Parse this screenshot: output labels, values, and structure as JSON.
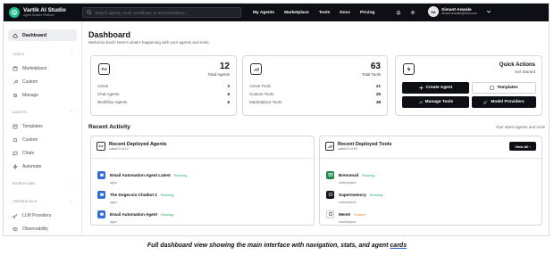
{
  "app": {
    "title": "Vartik AI Studio",
    "subtitle": "Agent Builder Platform"
  },
  "search": {
    "placeholder": "Search agents, tools, workflows, or documentation..."
  },
  "topnav": [
    "My Agents",
    "Marketplace",
    "Tools",
    "Docs",
    "Pricing"
  ],
  "user": {
    "initials": "SA",
    "name": "Simant Aswale",
    "email": "simant.aswale@emo.com"
  },
  "sidebar": {
    "dashboard": "Dashboard",
    "sections": [
      {
        "title": "TOOLS",
        "items": [
          "Marketplace",
          "Custom",
          "Manage"
        ]
      },
      {
        "title": "AGENTS",
        "items": [
          "Templates",
          "Custom",
          "Chats",
          "Automate"
        ]
      },
      {
        "title": "WORKFLOWS",
        "items": []
      },
      {
        "title": "CREDENTIALS",
        "items": [
          "LLM Providers",
          "Observability"
        ]
      }
    ]
  },
  "main": {
    "title": "Dashboard",
    "subtitle": "Welcome back! Here's what's happening with your agents and tools."
  },
  "agents_card": {
    "total": "12",
    "total_label": "Total Agents",
    "rows": [
      {
        "label": "Active",
        "value": "3"
      },
      {
        "label": "Chat Agents",
        "value": "6"
      },
      {
        "label": "Workflow Agents",
        "value": "6"
      }
    ]
  },
  "tools_card": {
    "total": "63",
    "total_label": "Total Tools",
    "rows": [
      {
        "label": "Active Tools",
        "value": "21"
      },
      {
        "label": "Custom Tools",
        "value": "25"
      },
      {
        "label": "Marketplace Tools",
        "value": "38"
      }
    ]
  },
  "quick_actions": {
    "title": "Quick Actions",
    "subtitle": "Get Started",
    "create_agent": "Create Agent",
    "templates": "Templates",
    "manage_tools": "Manage Tools",
    "model_providers": "Model Providers"
  },
  "recent_activity": {
    "title": "Recent Activity",
    "subtitle": "Your latest agents and tools"
  },
  "recent_agents": {
    "title": "Recent Deployed Agents",
    "subtitle": "Latest 3 of 12",
    "items": [
      {
        "name": "Email Automation Agent Latest",
        "status": "Running",
        "meta": "agno"
      },
      {
        "name": "The Dogecoin Chatbot 2",
        "status": "Running",
        "meta": "agno"
      },
      {
        "name": "Email Automation Agent",
        "status": "Running",
        "meta": "agno"
      }
    ]
  },
  "recent_tools": {
    "title": "Recent Deployed Tools",
    "subtitle": "Latest 3 of 63",
    "view_all": "View All",
    "items": [
      {
        "name": "Brevomail",
        "status": "Running",
        "meta": "marketplace"
      },
      {
        "name": "Supermemory",
        "status": "Running",
        "meta": "marketplace"
      },
      {
        "name": "Mem0",
        "status": "Paused",
        "meta": "marketplace"
      }
    ]
  },
  "colors": {
    "running": "#1faa59",
    "paused": "#e0891b",
    "accent": "#21c18f"
  },
  "caption": {
    "text": "Full dashboard view showing the main interface with navigation, stats, and agent ",
    "underlined": "cards"
  }
}
